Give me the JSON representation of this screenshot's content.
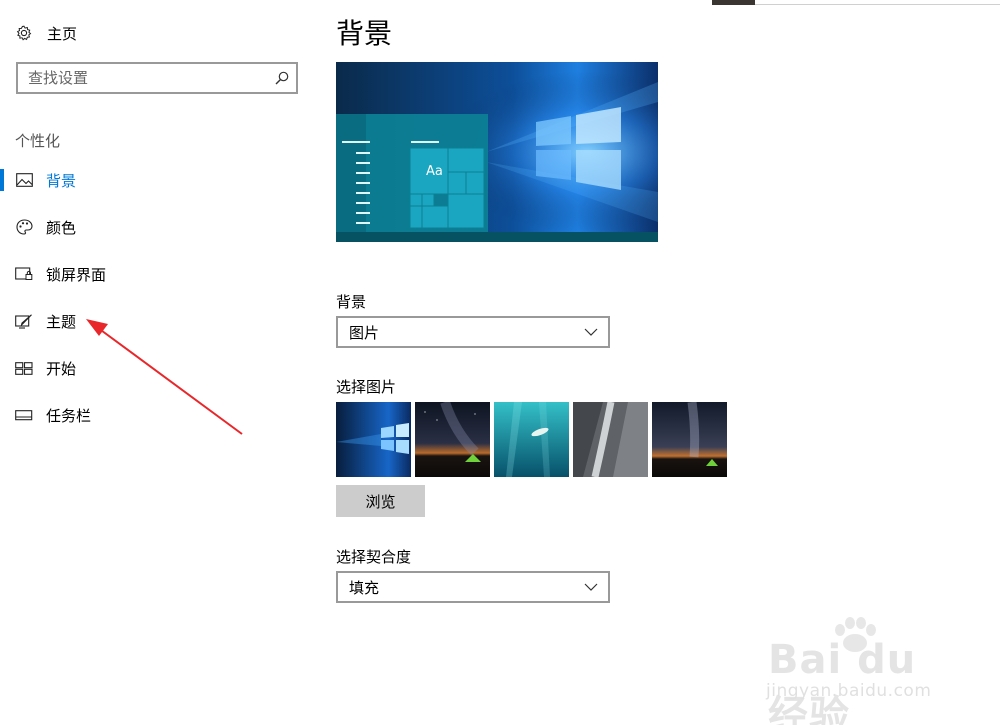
{
  "sidebar": {
    "home": {
      "label": "主页",
      "icon": "gear-icon"
    },
    "search": {
      "placeholder": "查找设置",
      "icon": "search-icon"
    },
    "section_title": "个性化",
    "items": [
      {
        "label": "背景",
        "icon": "picture-icon",
        "active": true
      },
      {
        "label": "颜色",
        "icon": "palette-icon",
        "active": false
      },
      {
        "label": "锁屏界面",
        "icon": "lock-screen-icon",
        "active": false
      },
      {
        "label": "主题",
        "icon": "theme-brush-icon",
        "active": false
      },
      {
        "label": "开始",
        "icon": "start-tiles-icon",
        "active": false
      },
      {
        "label": "任务栏",
        "icon": "taskbar-icon",
        "active": false
      }
    ]
  },
  "main": {
    "title": "背景",
    "preview": {
      "tile_text": "Aa"
    },
    "background": {
      "label": "背景",
      "value": "图片"
    },
    "choose_picture": {
      "label": "选择图片",
      "thumbnails": [
        "windows-blue",
        "night-sky-tent",
        "underwater-swimmer",
        "rock-cliff",
        "milky-way-tent"
      ]
    },
    "browse_label": "浏览",
    "fit": {
      "label": "选择契合度",
      "value": "填充"
    }
  },
  "watermark": {
    "brand": "Bai du 经验",
    "sub": "jingyan.baidu.com"
  },
  "colors": {
    "accent": "#0078d7",
    "annotation_arrow": "#e8272a",
    "border": "#999999",
    "button_bg": "#cccccc"
  }
}
